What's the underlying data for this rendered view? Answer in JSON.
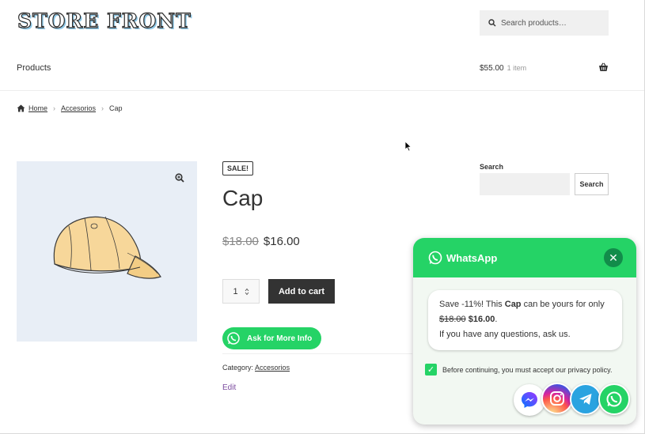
{
  "header": {
    "logo_text": "STORE FRONT",
    "search_placeholder": "Search products…",
    "nav_products": "Products",
    "cart_total": "$55.00",
    "cart_count": "1 item"
  },
  "breadcrumb": {
    "home": "Home",
    "category": "Accesorios",
    "current": "Cap"
  },
  "product": {
    "badge": "SALE!",
    "title": "Cap",
    "old_price": "$18.00",
    "new_price": "$16.00",
    "quantity": "1",
    "add_to_cart": "Add to cart",
    "ask_button": "Ask for More Info",
    "category_label": "Category:",
    "category_value": "Accesorios",
    "edit": "Edit"
  },
  "sidebar": {
    "search_label": "Search",
    "search_button": "Search"
  },
  "whatsapp_panel": {
    "title": "WhatsApp",
    "msg_prefix": "Save -11%! This",
    "msg_product": "Cap",
    "msg_suffix": "can be yours for only",
    "msg_old_price": "$18.00",
    "msg_new_price": "$16.00",
    "msg_line3": "If you have any questions, ask us.",
    "consent": "Before continuing, you must accept our privacy policy.",
    "consent_checked": true
  },
  "colors": {
    "whatsapp_green": "#25d366",
    "dark_button": "#333333",
    "image_bg": "#e8eef6"
  }
}
